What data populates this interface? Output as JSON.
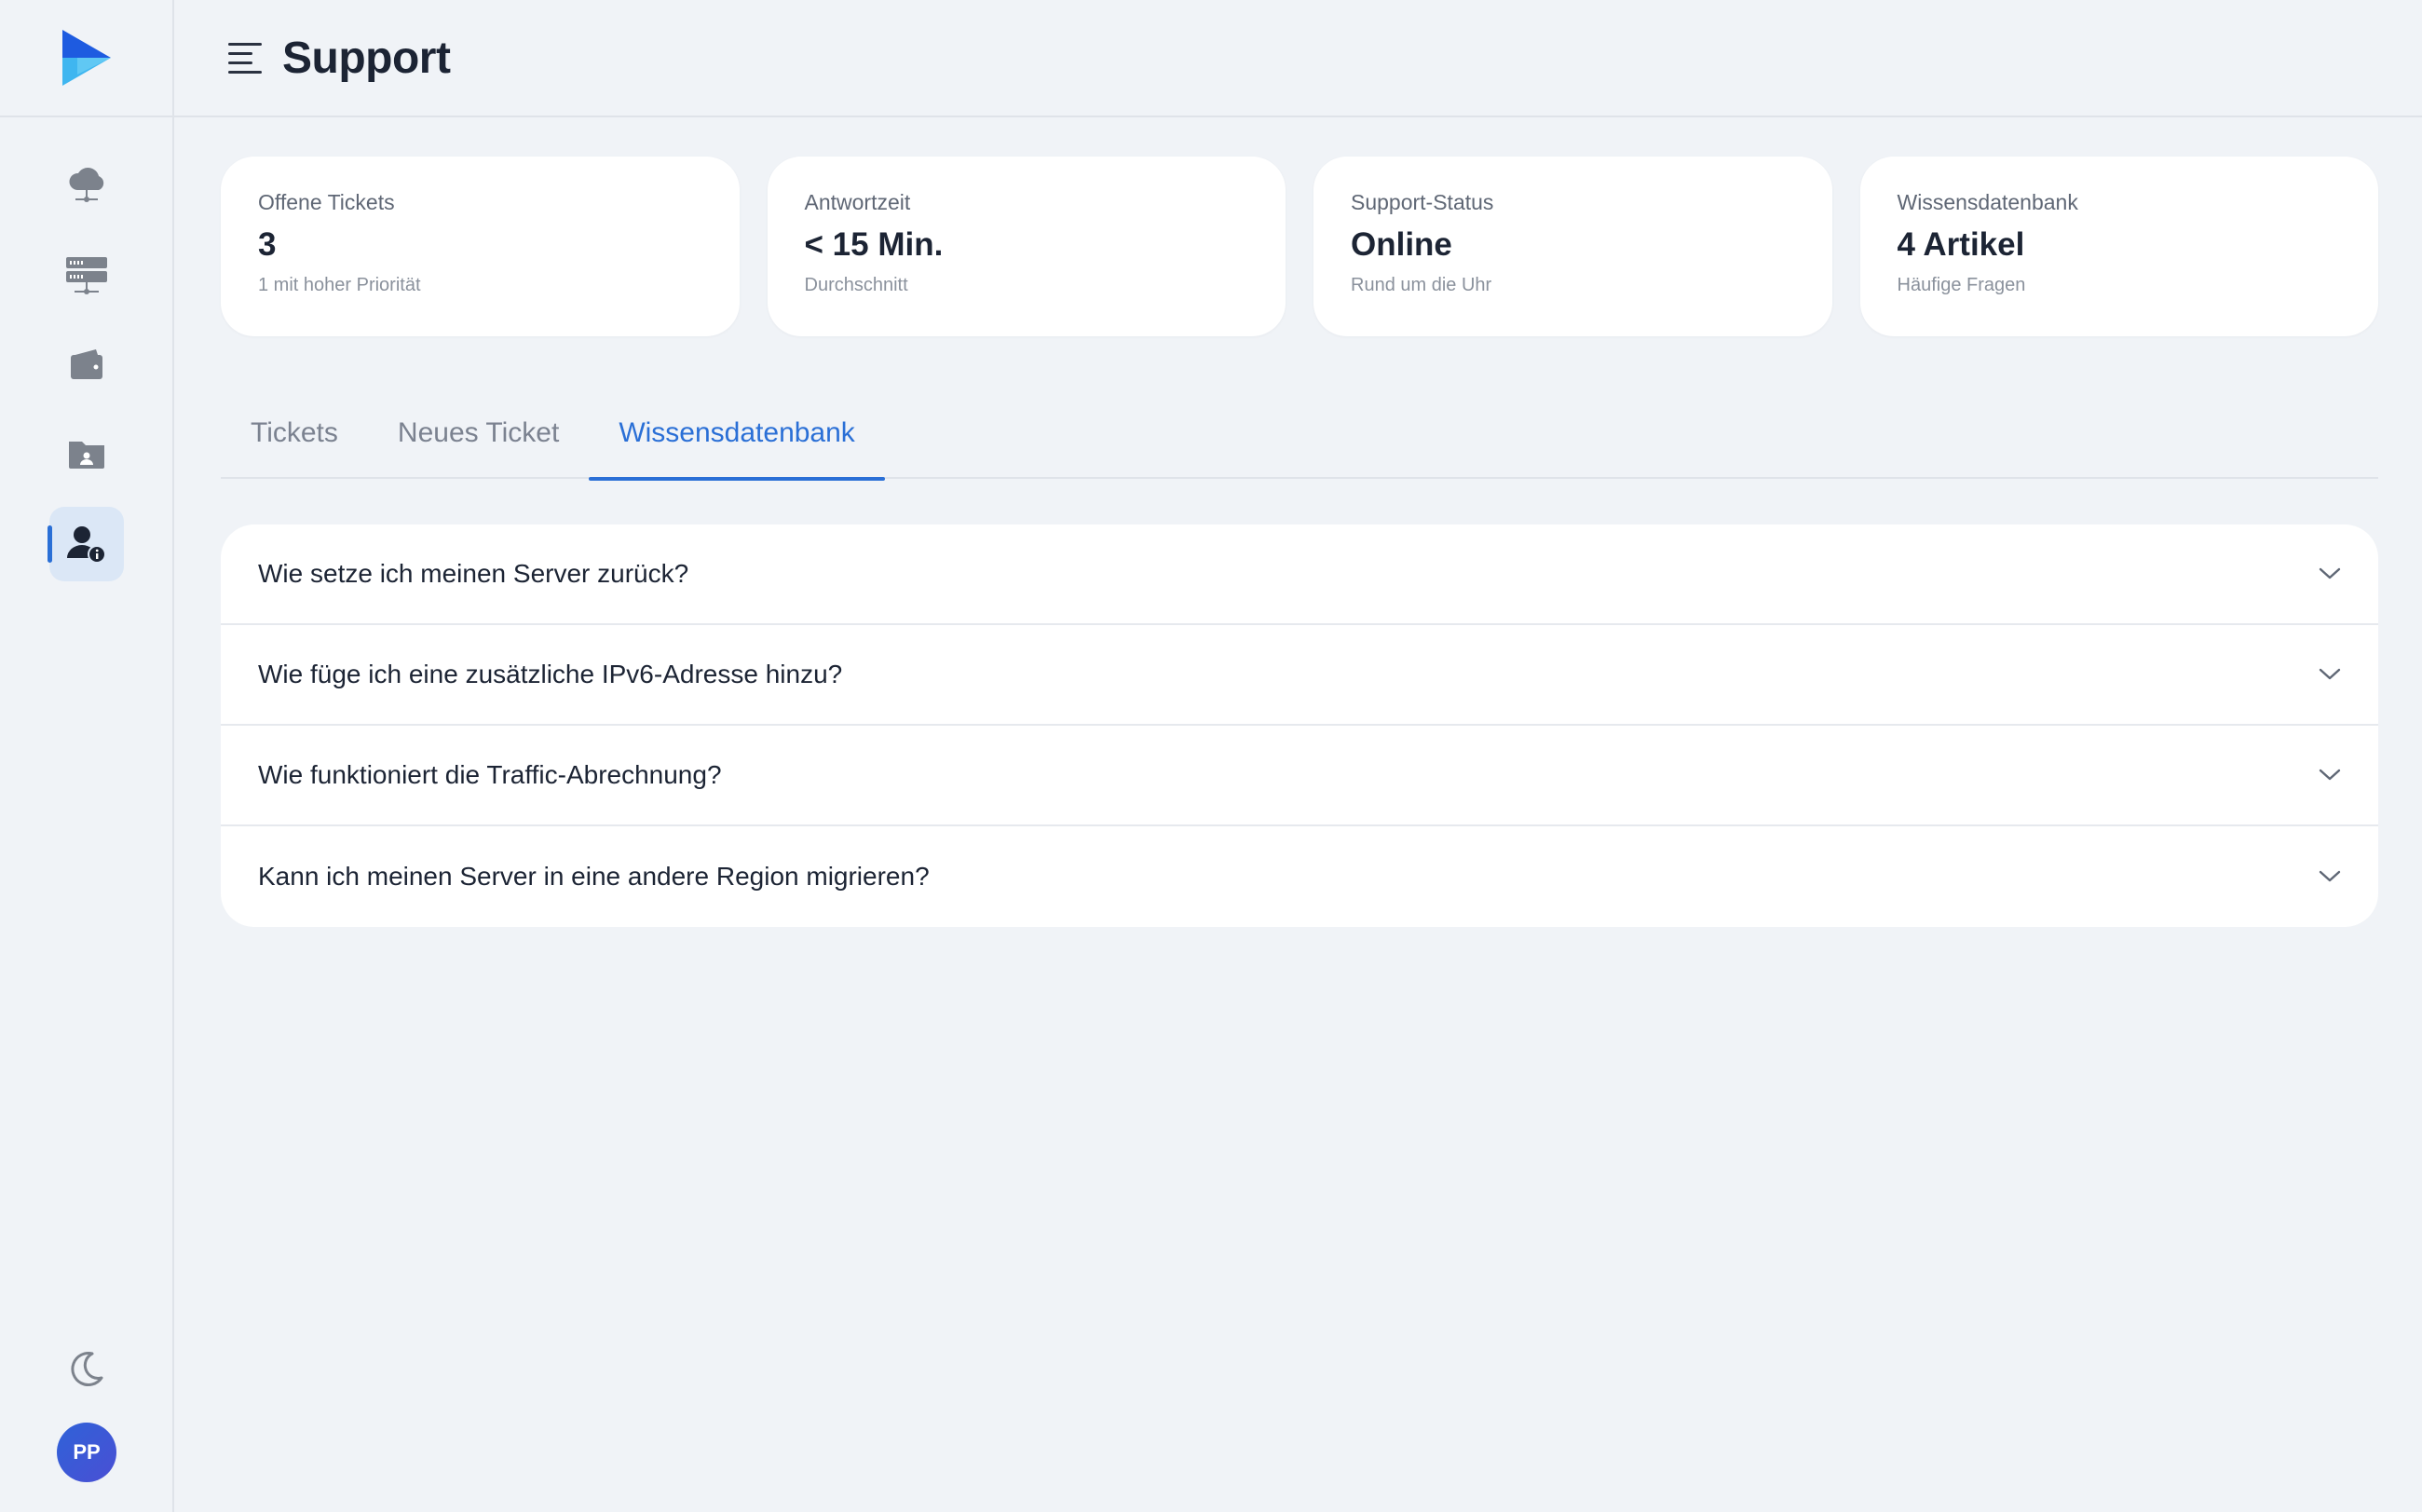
{
  "header": {
    "title": "Support"
  },
  "sidebar": {
    "items": [
      {
        "icon": "cloud-network-icon",
        "active": false
      },
      {
        "icon": "server-rack-icon",
        "active": false
      },
      {
        "icon": "wallet-icon",
        "active": false
      },
      {
        "icon": "folder-user-icon",
        "active": false
      },
      {
        "icon": "support-user-icon",
        "active": true
      }
    ],
    "user_initials": "PP"
  },
  "stats": [
    {
      "label": "Offene Tickets",
      "value": "3",
      "sub": "1 mit hoher Priorität"
    },
    {
      "label": "Antwortzeit",
      "value": "< 15 Min.",
      "sub": "Durchschnitt"
    },
    {
      "label": "Support-Status",
      "value": "Online",
      "sub": "Rund um die Uhr"
    },
    {
      "label": "Wissensdatenbank",
      "value": "4 Artikel",
      "sub": "Häufige Fragen"
    }
  ],
  "tabs": [
    {
      "label": "Tickets",
      "active": false
    },
    {
      "label": "Neues Ticket",
      "active": false
    },
    {
      "label": "Wissensdatenbank",
      "active": true
    }
  ],
  "faq": [
    {
      "question": "Wie setze ich meinen Server zurück?"
    },
    {
      "question": "Wie füge ich eine zusätzliche IPv6-Adresse hinzu?"
    },
    {
      "question": "Wie funktioniert die Traffic-Abrechnung?"
    },
    {
      "question": "Kann ich meinen Server in eine andere Region migrieren?"
    }
  ],
  "colors": {
    "accent": "#2a6fd6",
    "background": "#f0f3f7",
    "card": "#ffffff"
  }
}
